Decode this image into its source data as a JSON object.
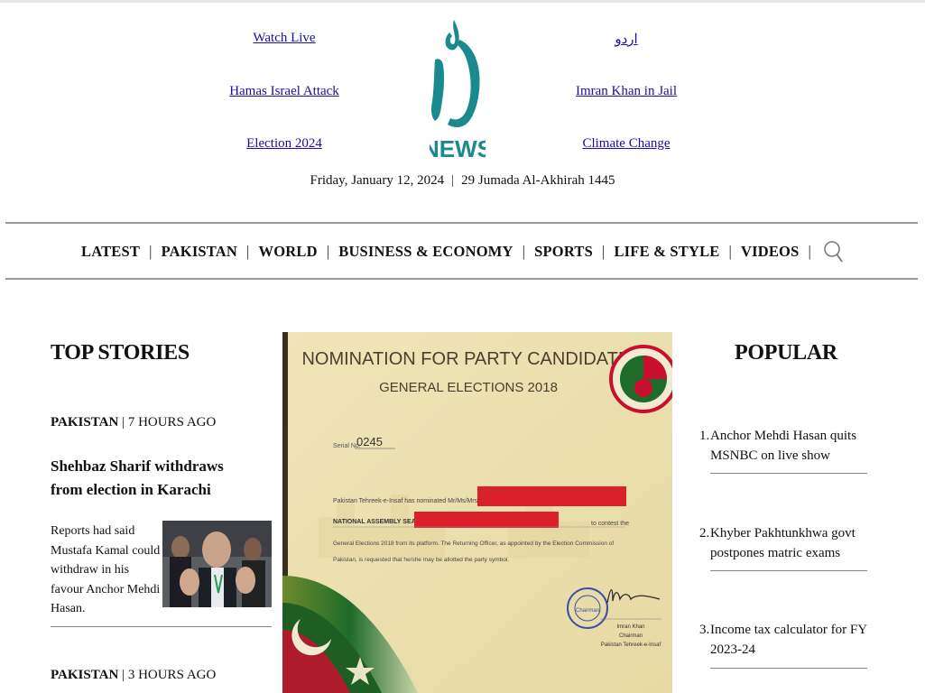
{
  "header": {
    "links_left": [
      "Watch Live",
      "Hamas Israel Attack",
      "Election 2024"
    ],
    "links_right": [
      "اردو",
      "Imran Khan in Jail",
      "Climate Change"
    ],
    "logo_text": "NEWS",
    "date": "Friday, January 12, 2024",
    "separator": "|",
    "hijri_date": "29 Jumada Al-Akhirah 1445"
  },
  "nav": {
    "items": [
      "LATEST",
      "PAKISTAN",
      "WORLD",
      "BUSINESS & ECONOMY",
      "SPORTS",
      "LIFE & STYLE",
      "VIDEOS"
    ],
    "separator": "|",
    "search_icon": "search-icon"
  },
  "top_stories": {
    "title": "TOP STORIES",
    "stories": [
      {
        "section": "PAKISTAN",
        "time": "7 HOURS AGO",
        "headline": "Shehbaz Sharif withdraws from election in Karachi",
        "excerpt": "Reports had said Mustafa Kamal could withdraw in his favour Anchor Mehdi Hasan."
      },
      {
        "section": "PAKISTAN",
        "time": "3 HOURS AGO"
      }
    ]
  },
  "hero": {
    "doc_title": "NOMINATION FOR PARTY CANDIDATES",
    "doc_subtitle": "GENERAL ELECTIONS 2018",
    "serial_label": "Serial No.",
    "serial_value": "0245",
    "line1": "Pakistan Tehreek-e-Insaf has nominated Mr/Ms/Mrs",
    "line2_label": "NATIONAL ASSEMBLY SEAT #",
    "line2_suffix": "to contest the",
    "body1": "General Elections 2018 from its platform. The Returning Officer, as appointed by the Election Commission of",
    "body2": "Pakistan, is requested that he/she may be allotted the party symbol.",
    "sig_name": "Imran Khan",
    "sig_role": "Chairman",
    "sig_org": "Pakistan Tehreek-e-Insaf",
    "stamp_text": "Chairman"
  },
  "popular": {
    "title": "POPULAR",
    "items": [
      {
        "num": "1.",
        "text": "Anchor Mehdi Hasan quits MSNBC on live show"
      },
      {
        "num": "2.",
        "text": "Khyber Pakhtunkhwa govt postpones matric exams"
      },
      {
        "num": "3.",
        "text": "Income tax calculator for FY 2023-24"
      }
    ]
  },
  "colors": {
    "logo_teal": "#1b8a8f",
    "link": "#1a0dab",
    "redaction": "#d9202b",
    "pti_green": "#1e6b2a",
    "pti_red": "#c8102e"
  }
}
